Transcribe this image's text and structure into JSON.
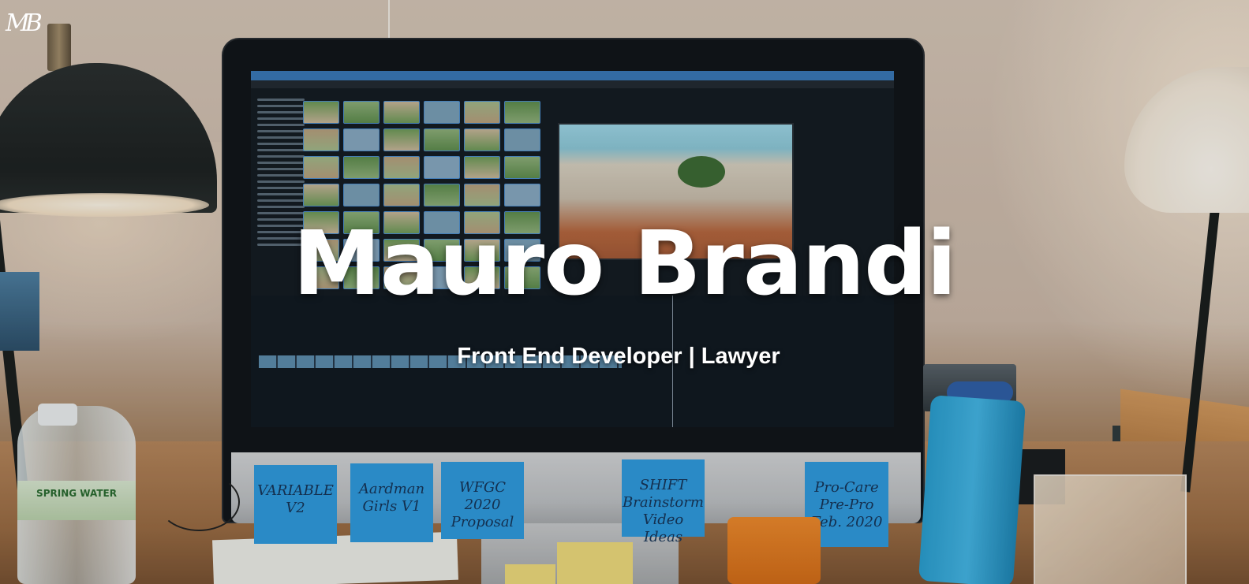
{
  "logo": {
    "text": "MB"
  },
  "hero": {
    "title": "Mauro Brandi",
    "subtitle": "Front End Developer | Lawyer"
  },
  "background_photo": {
    "sticky_notes": [
      "VARIABLE V2",
      "Aardman Girls V1",
      "WFGC 2020 Proposal",
      "SHIFT Brainstorm Video Ideas",
      "Pro-Care Pre-Pro Feb. 2020"
    ],
    "bottle_label": "SPRING WATER"
  },
  "colors": {
    "title_text": "#ffffff",
    "sticky_blue": "#2f9be0",
    "screen_bg": "#141b22"
  }
}
